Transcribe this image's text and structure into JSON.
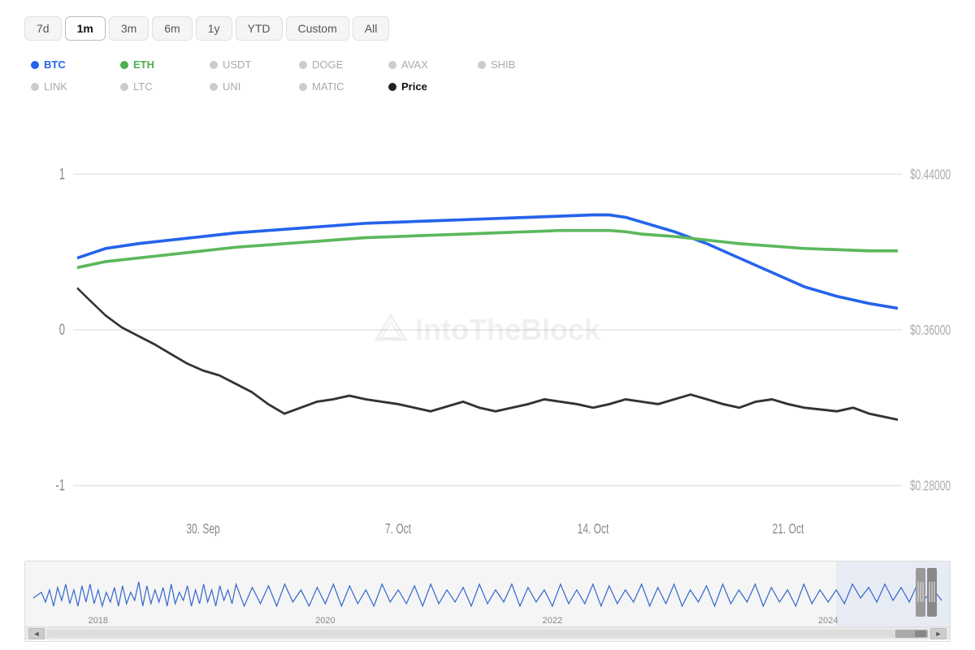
{
  "timeRange": {
    "buttons": [
      "7d",
      "1m",
      "3m",
      "6m",
      "1y",
      "YTD",
      "Custom",
      "All"
    ],
    "active": "1m"
  },
  "legend": {
    "row1": [
      {
        "id": "BTC",
        "color": "#2563eb",
        "label": "BTC",
        "active": true
      },
      {
        "id": "ETH",
        "color": "#4caf50",
        "label": "ETH",
        "active": true
      },
      {
        "id": "USDT",
        "color": "#cccccc",
        "label": "USDT",
        "active": false
      },
      {
        "id": "DOGE",
        "color": "#cccccc",
        "label": "DOGE",
        "active": false
      },
      {
        "id": "AVAX",
        "color": "#cccccc",
        "label": "AVAX",
        "active": false
      },
      {
        "id": "SHIB",
        "color": "#cccccc",
        "label": "SHIB",
        "active": false
      }
    ],
    "row2": [
      {
        "id": "LINK",
        "color": "#cccccc",
        "label": "LINK",
        "active": false
      },
      {
        "id": "LTC",
        "color": "#cccccc",
        "label": "LTC",
        "active": false
      },
      {
        "id": "UNI",
        "color": "#cccccc",
        "label": "UNI",
        "active": false
      },
      {
        "id": "MATIC",
        "color": "#cccccc",
        "label": "MATIC",
        "active": false
      },
      {
        "id": "Price",
        "color": "#222222",
        "label": "Price",
        "active": true
      }
    ]
  },
  "chart": {
    "yAxisLeft": [
      "1",
      "0",
      "-1"
    ],
    "yAxisRight": [
      "$0.440000",
      "$0.360000",
      "$0.280000"
    ],
    "xAxisLabels": [
      "30. Sep",
      "7. Oct",
      "14. Oct",
      "21. Oct"
    ],
    "watermark": "IntoTheBlock"
  },
  "navigator": {
    "xLabels": [
      "2018",
      "2020",
      "2022",
      "2024"
    ],
    "arrowLeft": "◄",
    "arrowRight": "►"
  }
}
